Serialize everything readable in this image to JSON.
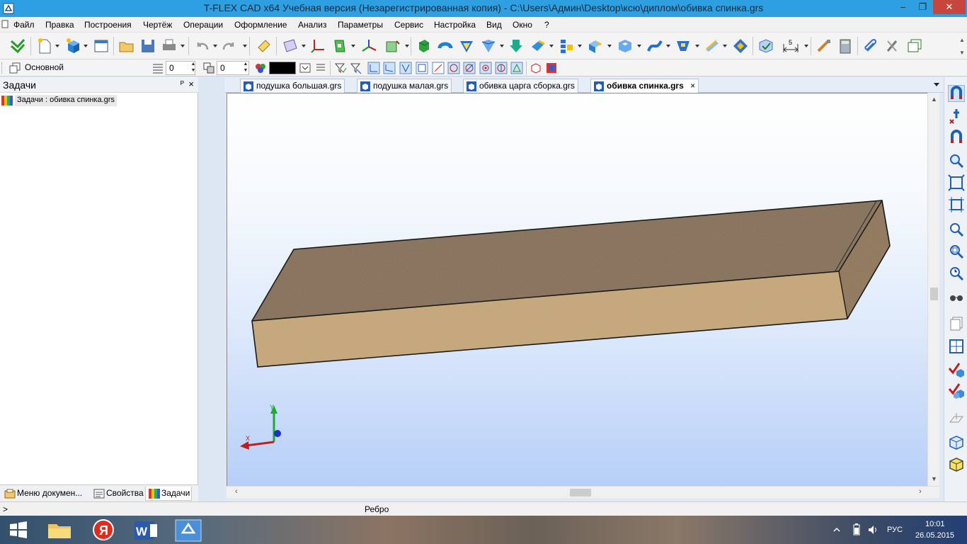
{
  "window": {
    "title": "T-FLEX CAD x64 Учебная версия (Незарегистрированная копия) - C:\\Users\\Админ\\Desktop\\ксю\\диплом\\обивка спинка.grs",
    "minimize": "–",
    "restore": "❐",
    "close": "✕"
  },
  "menu": {
    "file": "Файл",
    "edit": "Правка",
    "build": "Построения",
    "drawing": "Чертёж",
    "operations": "Операции",
    "design": "Оформление",
    "analysis": "Анализ",
    "parameters": "Параметры",
    "service": "Сервис",
    "settings": "Настройка",
    "view": "Вид",
    "window": "Окно",
    "help": "?"
  },
  "toolbar2": {
    "layer_name": "Основной",
    "level_value": "0",
    "priority_value": "0",
    "color_value": "#000000"
  },
  "left_panel": {
    "title": "Задачи",
    "pin": "ᴾ",
    "close": "×",
    "task_item": "Задачи : обивка спинка.grs",
    "tabs": {
      "doc_menu": "Меню докумен...",
      "properties": "Свойства",
      "tasks": "Задачи"
    }
  },
  "doc_tabs": {
    "tab1": "подушка большая.grs",
    "tab2": "подушка малая.grs",
    "tab3": "обивка царга сборка.grs",
    "tab4": "обивка спинка.grs",
    "close": "×"
  },
  "viewport": {
    "axis_y": "Y",
    "axis_x": "X"
  },
  "status": {
    "prompt": ">",
    "message": "Ребро"
  },
  "taskbar": {
    "language": "РУС",
    "time": "10:01",
    "date": "26.05.2015"
  }
}
